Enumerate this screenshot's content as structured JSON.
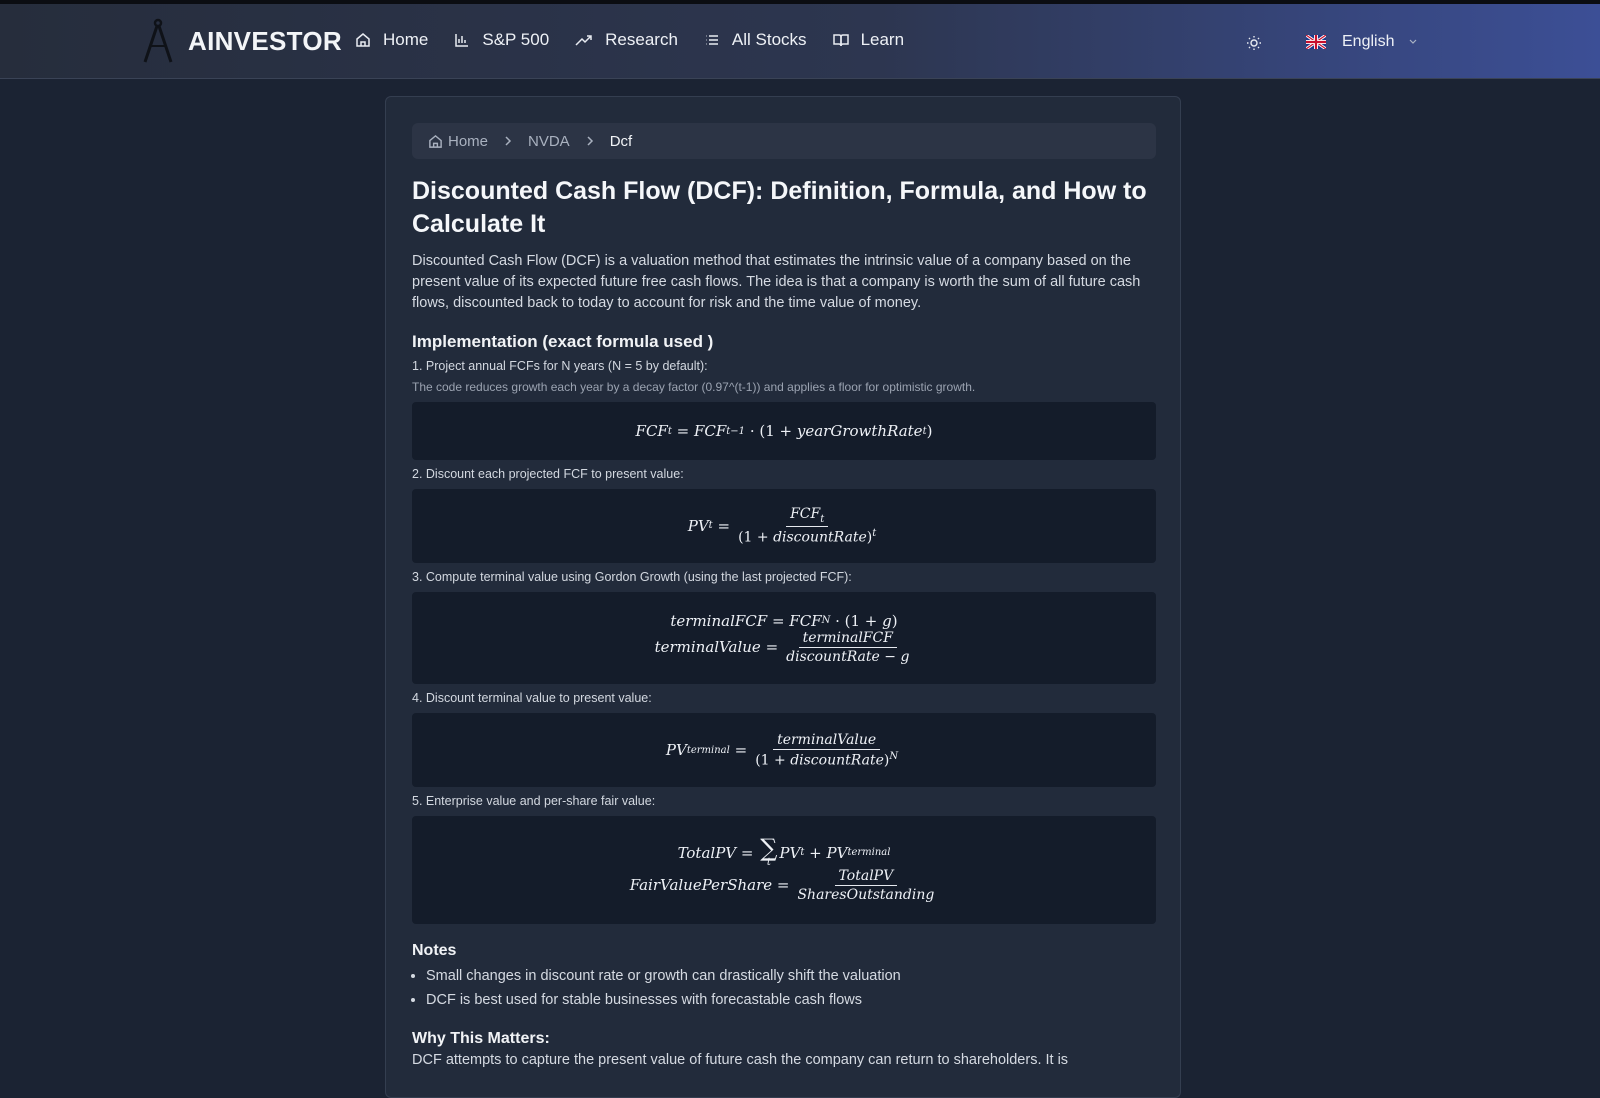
{
  "navbar": {
    "brand": "AINVESTOR",
    "items": [
      {
        "label": "Home",
        "icon": "home-icon"
      },
      {
        "label": "S&P 500",
        "icon": "bar-chart-icon"
      },
      {
        "label": "Research",
        "icon": "trending-up-icon"
      },
      {
        "label": "All Stocks",
        "icon": "list-icon"
      },
      {
        "label": "Learn",
        "icon": "book-open-icon"
      }
    ],
    "language": "English"
  },
  "breadcrumb": {
    "home": "Home",
    "ticker": "NVDA",
    "current": "Dcf"
  },
  "article": {
    "title": "Discounted Cash Flow (DCF): Definition, Formula, and How to Calculate It",
    "intro": "Discounted Cash Flow (DCF) is a valuation method that estimates the intrinsic value of a company based on the present value of its expected future free cash flows. The idea is that a company is worth the sum of all future cash flows, discounted back to today to account for risk and the time value of money.",
    "implementation_heading": "Implementation (exact formula used )",
    "steps": [
      {
        "label": "1. Project annual FCFs for N years (N = 5 by default):",
        "note": "The code reduces growth each year by a decay factor (0.97^(t-1)) and applies a floor for optimistic growth."
      },
      {
        "label": "2. Discount each projected FCF to present value:"
      },
      {
        "label": "3. Compute terminal value using Gordon Growth (using the last projected FCF):"
      },
      {
        "label": "4. Discount terminal value to present value:"
      },
      {
        "label": "5. Enterprise value and per-share fair value:"
      }
    ],
    "notes_heading": "Notes",
    "notes": [
      "Small changes in discount rate or growth can drastically shift the valuation",
      "DCF is best used for stable businesses with forecastable cash flows"
    ],
    "why_heading": "Why This Matters:",
    "why_text": "DCF attempts to capture the present value of future cash the company can return to shareholders. It is"
  }
}
